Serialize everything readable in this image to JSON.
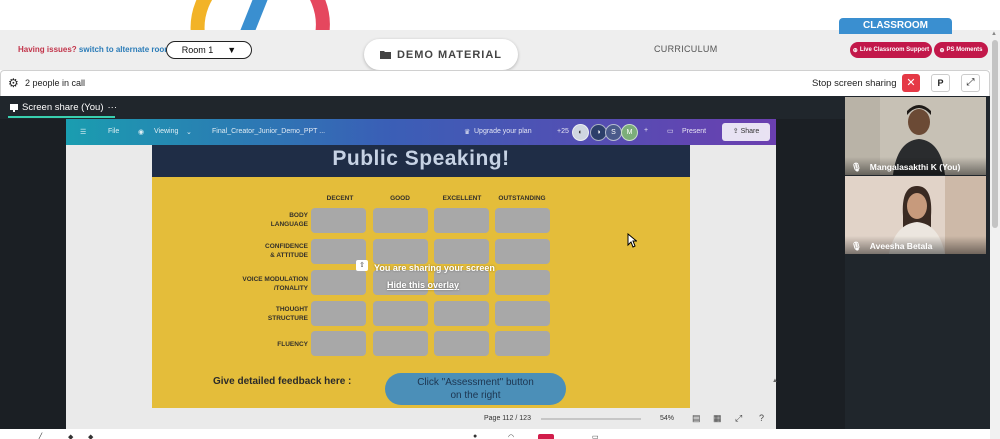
{
  "header": {
    "issues_text": "Having issues?",
    "switch_link": "switch to alternate room",
    "room_select_value": "Room 1",
    "demo_material_label": "DEMO MATERIAL",
    "curriculum_label": "CURRICULUM",
    "classroom_tab_label": "CLASSROOM",
    "live_support_label": "Live Classroom Support",
    "ps_moments_label": "PS Moments"
  },
  "callbar": {
    "people_count_text": "2 people in call",
    "stop_sharing_label": "Stop screen sharing",
    "p_button_label": "P"
  },
  "screen_share": {
    "tab_label": "Screen share (You)",
    "tab_more": "···",
    "overlay_message": "You are sharing your screen",
    "hide_overlay_link": "Hide this overlay"
  },
  "canva": {
    "file_menu": "File",
    "viewing_label": "Viewing",
    "doc_name": "Final_Creator_Junior_Demo_PPT ...",
    "upgrade_label": "Upgrade your plan",
    "collab_count": "+25",
    "avatar_s": "S",
    "avatar_m": "M",
    "present_label": "Present",
    "share_label": "Share",
    "page_indicator": "Page 112 / 123",
    "zoom_level": "54%"
  },
  "slide": {
    "title": "Public Speaking!",
    "columns": [
      "DECENT",
      "GOOD",
      "EXCELLENT",
      "OUTSTANDING"
    ],
    "rows": [
      [
        "BODY",
        "LANGUAGE"
      ],
      [
        "CONFIDENCE",
        "& ATTITUDE"
      ],
      [
        "VOICE MODULATION",
        "/TONALITY"
      ],
      [
        "THOUGHT",
        "STRUCTURE"
      ],
      [
        "FLUENCY"
      ]
    ],
    "feedback_label": "Give detailed feedback here :",
    "assessment_button": [
      "Click \"Assessment\" button",
      "on the right"
    ]
  },
  "participants": [
    {
      "name": "Mangalasakthi K (You)"
    },
    {
      "name": "Aveesha Betala"
    }
  ],
  "colors": {
    "accent_red": "#c2184a",
    "classroom_blue": "#3a8fd0",
    "stop_red": "#e53946",
    "stage_dark": "#20262c",
    "slide_yellow": "#e4bd3a",
    "share_underline": "#39d0b0"
  },
  "icons": {
    "settings": "gear-icon",
    "folder": "folder-icon",
    "close": "close-icon",
    "expand": "expand-icon",
    "microphone": "microphone-icon",
    "screen_share": "screen-share-icon",
    "cursor": "mouse-pointer-icon"
  }
}
